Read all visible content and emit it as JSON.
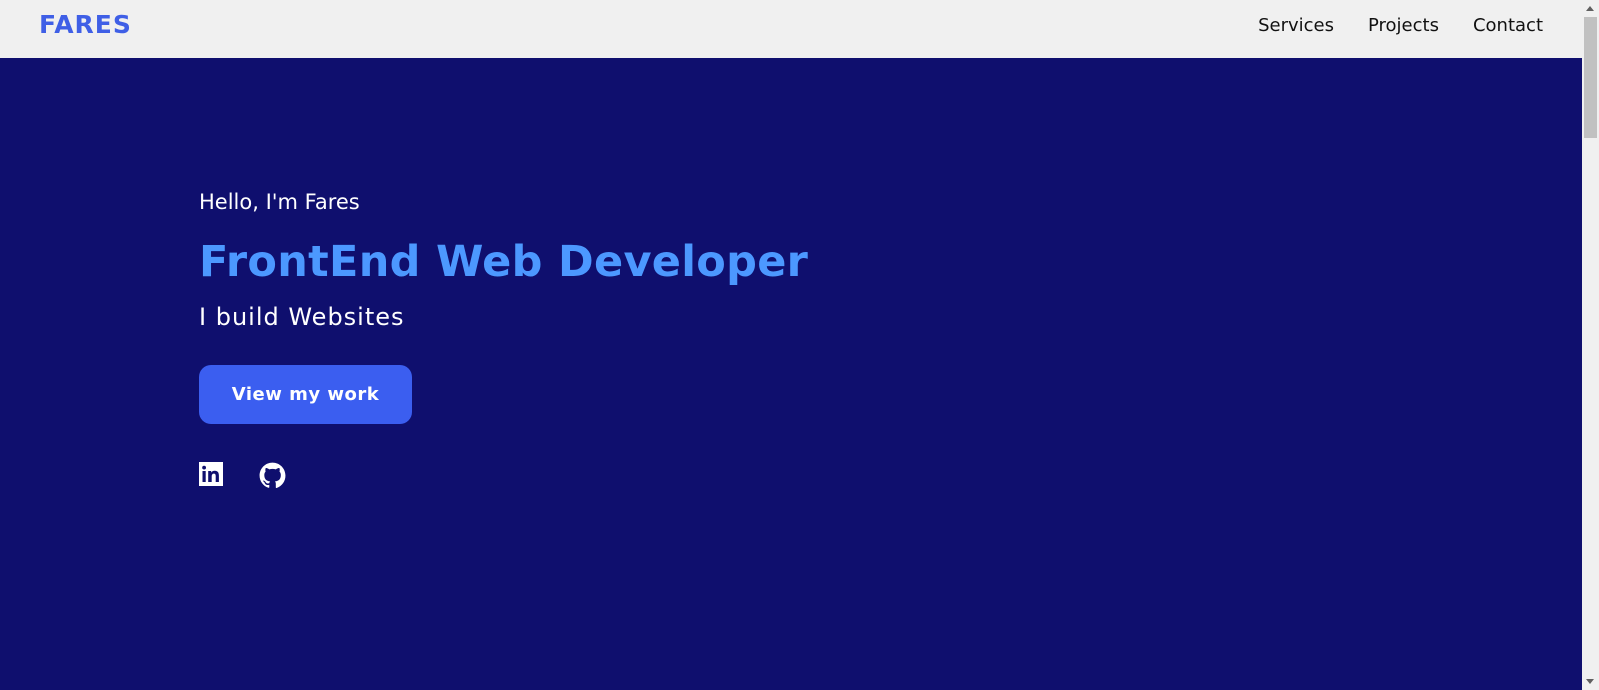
{
  "brand": {
    "logo": "FARES"
  },
  "nav": {
    "links": [
      {
        "label": "Services"
      },
      {
        "label": "Projects"
      },
      {
        "label": "Contact"
      }
    ]
  },
  "hero": {
    "greeting": "Hello, I'm Fares",
    "title": "FrontEnd Web Developer",
    "subtitle": "I build Websites",
    "cta_label": "View my work"
  },
  "socials": [
    {
      "icon": "linkedin-icon"
    },
    {
      "icon": "github-icon"
    }
  ],
  "colors": {
    "nav_bg": "#f0f0f0",
    "hero_bg": "#0f0f6e",
    "brand": "#3f5fe6",
    "headline": "#4c98ff",
    "cta_bg": "#3b5ef0"
  }
}
